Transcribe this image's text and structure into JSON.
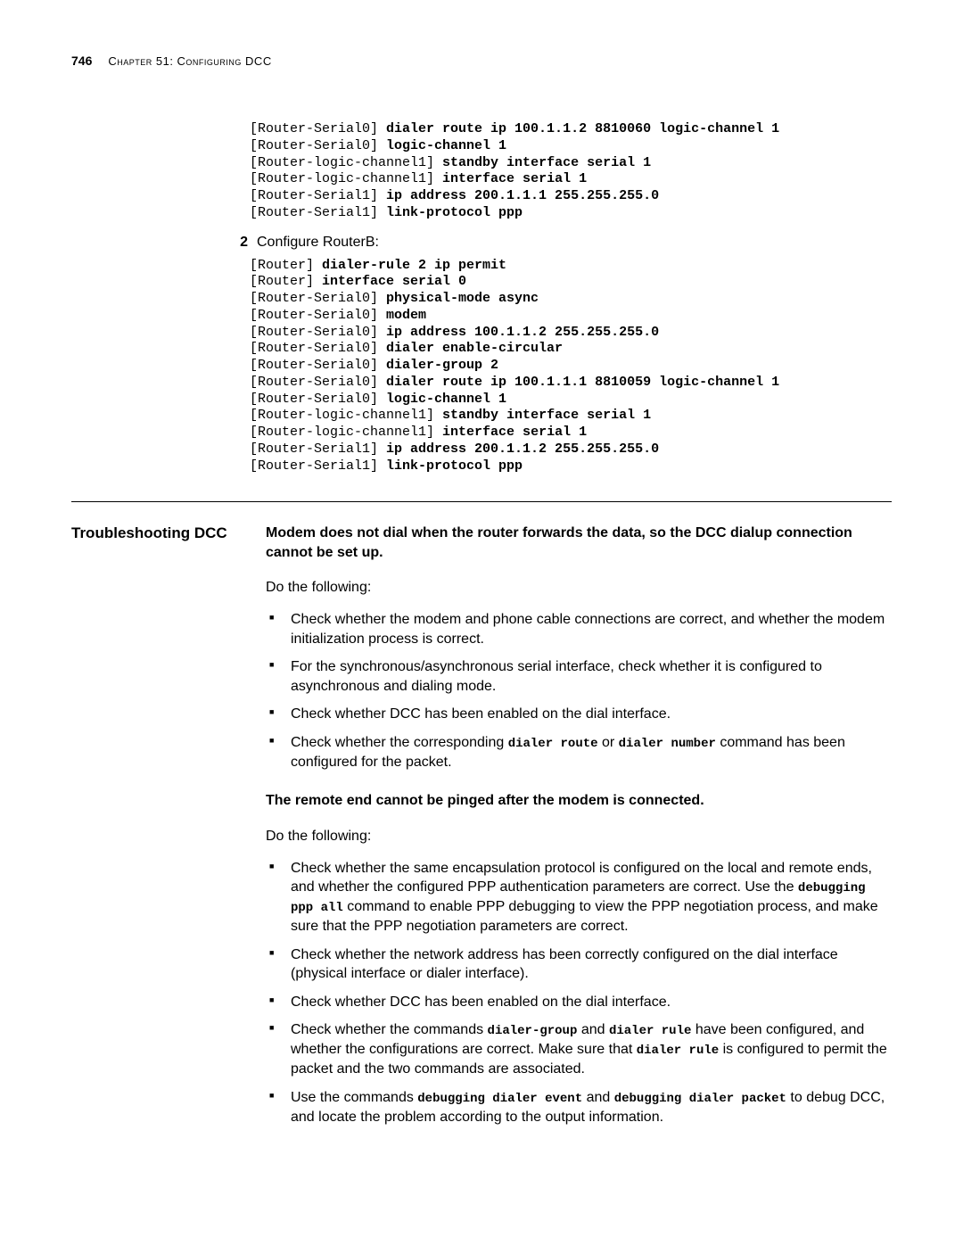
{
  "header": {
    "page_number": "746",
    "chapter": "Chapter 51: Configuring DCC"
  },
  "codeA": {
    "l1p": "[Router-Serial0] ",
    "l1b": "dialer route ip 100.1.1.2 8810060 logic-channel 1",
    "l2p": "[Router-Serial0] ",
    "l2b": "logic-channel 1",
    "l3p": "[Router-logic-channel1] ",
    "l3b": "standby interface serial 1",
    "l4p": "[Router-logic-channel1] ",
    "l4b": "interface serial 1",
    "l5p": "[Router-Serial1] ",
    "l5b": "ip address 200.1.1.1 255.255.255.0",
    "l6p": "[Router-Serial1] ",
    "l6b": "link-protocol ppp"
  },
  "step2": {
    "num": "2",
    "text": "Configure RouterB:"
  },
  "codeB": {
    "l1p": "[Router] ",
    "l1b": "dialer-rule 2 ip permit",
    "l2p": "[Router] ",
    "l2b": "interface serial 0",
    "l3p": "[Router-Serial0] ",
    "l3b": "physical-mode async",
    "l4p": "[Router-Serial0] ",
    "l4b": "modem",
    "l5p": "[Router-Serial0] ",
    "l5b": "ip address 100.1.1.2 255.255.255.0",
    "l6p": "[Router-Serial0] ",
    "l6b": "dialer enable-circular",
    "l7p": "[Router-Serial0] ",
    "l7b": "dialer-group 2",
    "l8p": "[Router-Serial0] ",
    "l8b": "dialer route ip 100.1.1.1 8810059 logic-channel 1",
    "l9p": "[Router-Serial0] ",
    "l9b": "logic-channel 1",
    "l10p": "[Router-logic-channel1] ",
    "l10b": "standby interface serial 1",
    "l11p": "[Router-logic-channel1] ",
    "l11b": "interface serial 1",
    "l12p": "[Router-Serial1] ",
    "l12b": "ip address 200.1.1.2 255.255.255.0",
    "l13p": "[Router-Serial1] ",
    "l13b": "link-protocol ppp"
  },
  "troubleshoot": {
    "label": "Troubleshooting DCC",
    "h1": "Modem does not dial when the router forwards the data, so the DCC dialup connection cannot be set up.",
    "do1": "Do the following:",
    "b1_1": "Check whether the modem and phone cable connections are correct, and whether the modem initialization process is correct.",
    "b1_2": "For the synchronous/asynchronous serial interface, check whether it is configured to asynchronous and dialing mode.",
    "b1_3": "Check whether DCC has been enabled on the dial interface.",
    "b1_4a": "Check whether the corresponding ",
    "b1_4c1": "dialer route",
    "b1_4m": " or ",
    "b1_4c2": "dialer number",
    "b1_4b": " command has been configured for the packet.",
    "h2": "The remote end cannot be pinged after the modem is connected.",
    "do2": "Do the following:",
    "b2_1a": "Check whether the same encapsulation protocol is configured on the local and remote ends, and whether the configured PPP authentication parameters are correct. Use the ",
    "b2_1c": "debugging ppp all",
    "b2_1b": " command to enable PPP debugging to view the PPP negotiation process, and make sure that the PPP negotiation parameters are correct.",
    "b2_2": "Check whether the network address has been correctly configured on the dial interface (physical interface or dialer interface).",
    "b2_3": "Check whether DCC has been enabled on the dial interface.",
    "b2_4a": "Check whether the commands ",
    "b2_4c1": "dialer-group",
    "b2_4m1": " and ",
    "b2_4c2": "dialer rule",
    "b2_4m2": " have been configured, and whether the configurations are correct. Make sure that ",
    "b2_4c3": "dialer rule",
    "b2_4b": " is configured to permit the packet and the two commands are associated.",
    "b2_5a": "Use the commands ",
    "b2_5c1": "debugging dialer event",
    "b2_5m": " and ",
    "b2_5c2": "debugging dialer packet",
    "b2_5b": " to debug DCC, and locate the problem according to the output information."
  }
}
